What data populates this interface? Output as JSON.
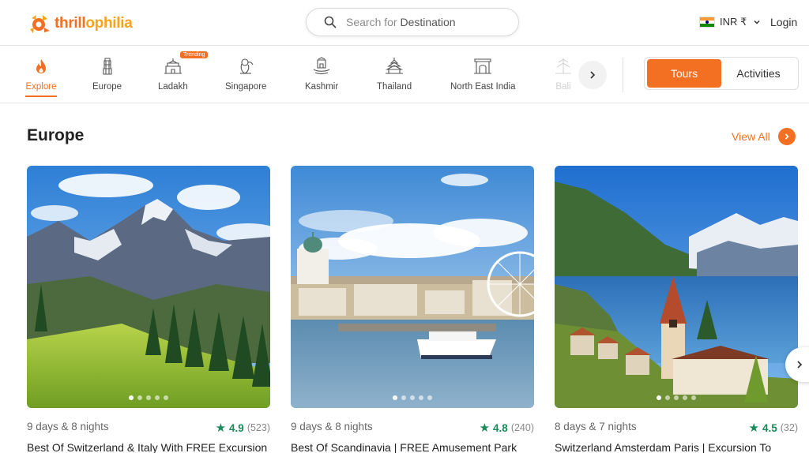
{
  "brand": {
    "name_part1": "thrill",
    "name_part2": "ophilia"
  },
  "search": {
    "prefix": "Search for ",
    "keyword": "Destination"
  },
  "header": {
    "currency": "INR ₹",
    "login": "Login"
  },
  "categories": [
    {
      "label": "Explore",
      "icon": "flame-icon"
    },
    {
      "label": "Europe",
      "icon": "leaning-tower-icon"
    },
    {
      "label": "Ladakh",
      "icon": "monastery-icon"
    },
    {
      "label": "Singapore",
      "icon": "merlion-icon"
    },
    {
      "label": "Kashmir",
      "icon": "shikara-icon"
    },
    {
      "label": "Thailand",
      "icon": "temple-icon"
    },
    {
      "label": "North East India",
      "icon": "gate-icon"
    },
    {
      "label": "Bali",
      "icon": "pura-icon"
    }
  ],
  "trending_badge": "Trending",
  "toggle": {
    "tours": "Tours",
    "activities": "Activities"
  },
  "section": {
    "title": "Europe",
    "view_all": "View All"
  },
  "cards": [
    {
      "duration": "9 days & 8 nights",
      "rating": "4.9",
      "reviews": "(523)",
      "title": "Best Of Switzerland & Italy With FREE Excursion"
    },
    {
      "duration": "9 days & 8 nights",
      "rating": "4.8",
      "reviews": "(240)",
      "title": "Best Of Scandinavia | FREE Amusement Park"
    },
    {
      "duration": "8 days & 7 nights",
      "rating": "4.5",
      "reviews": "(32)",
      "title": "Switzerland Amsterdam Paris | Excursion To"
    }
  ],
  "colors": {
    "accent": "#f37022",
    "rating_green": "#1b8a5a"
  }
}
